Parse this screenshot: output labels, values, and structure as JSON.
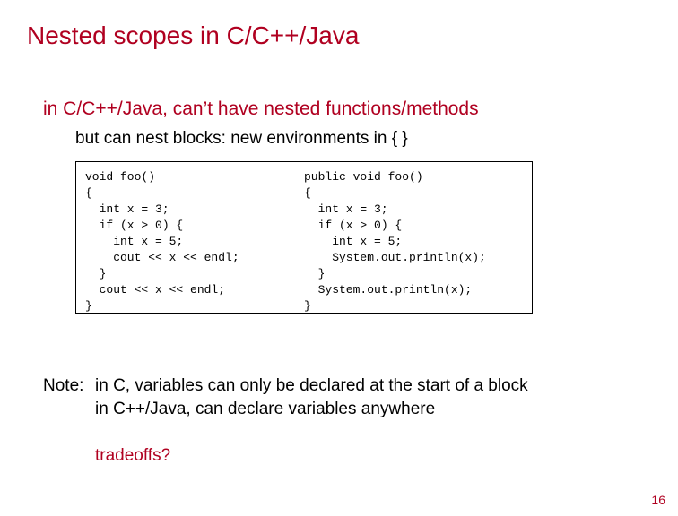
{
  "title": "Nested scopes in C/C++/Java",
  "sub1": "in C/C++/Java, can’t have nested functions/methods",
  "sub2": "but can nest blocks: new environments in { }",
  "code_left": "void foo()\n{\n  int x = 3;\n  if (x > 0) {\n    int x = 5;\n    cout << x << endl;\n  }\n  cout << x << endl;\n}",
  "code_right": "public void foo()\n{\n  int x = 3;\n  if (x > 0) {\n    int x = 5;\n    System.out.println(x);\n  }\n  System.out.println(x);\n}",
  "note_label": "Note:",
  "note_line1": "in C, variables can only be declared at the start of a block",
  "note_line2": "in C++/Java, can declare variables anywhere",
  "tradeoffs": "tradeoffs?",
  "pagenum": "16",
  "colors": {
    "accent": "#b00020",
    "text": "#000000",
    "bg": "#ffffff"
  }
}
